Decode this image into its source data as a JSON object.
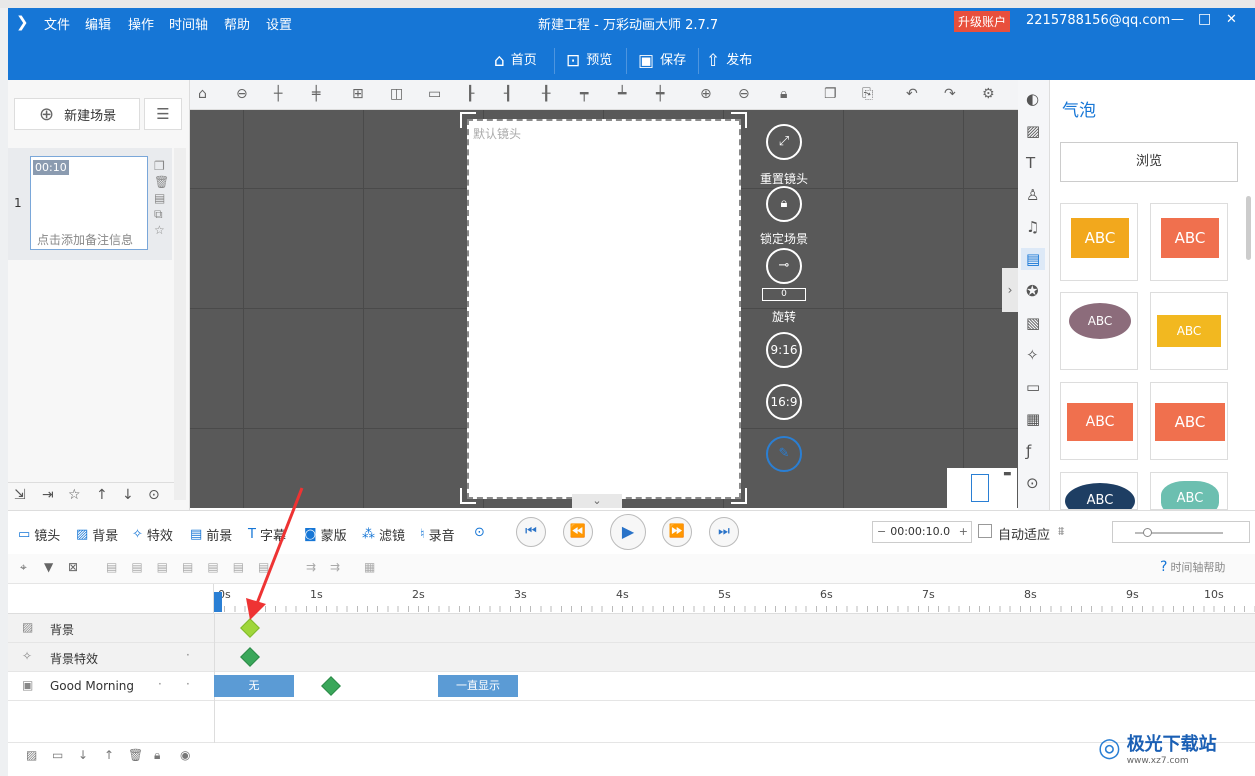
{
  "window": {
    "title": "新建工程 - 万彩动画大师 2.7.7",
    "upgrade": "升级账户",
    "account": "2215788156@qq.com",
    "controls": [
      "—",
      "□",
      "✕"
    ]
  },
  "menu": [
    "文件",
    "编辑",
    "操作",
    "时间轴",
    "帮助",
    "设置"
  ],
  "main_buttons": [
    "首页",
    "预览",
    "保存",
    "发布"
  ],
  "scene_panel": {
    "new_scene": "新建场景",
    "scene_index": "1",
    "scene_time": "00:10",
    "note_placeholder": "点击添加备注信息"
  },
  "canvas": {
    "camera_label": "默认镜头",
    "reset_camera": "重置镜头",
    "lock_scene": "锁定场景",
    "rotate_value": "0",
    "rotate_label": "旋转",
    "ratio_916": "9:16",
    "ratio_169": "16:9"
  },
  "right_panel": {
    "title": "气泡",
    "browse": "浏览",
    "cards": [
      "ABC",
      "ABC",
      "ABC",
      "ABC",
      "ABC",
      "ABC",
      "ABC",
      "ABC"
    ],
    "colors": [
      "#f2a81d",
      "#f0704e",
      "#8c6c7b",
      "#f2b820",
      "#f0704e",
      "#f0704e",
      "#1e3e63",
      "#6cbfb0"
    ]
  },
  "controls": {
    "tabs": [
      "镜头",
      "背景",
      "特效",
      "前景",
      "字幕",
      "蒙版",
      "滤镜",
      "录音"
    ],
    "time": "00:00:10.0",
    "auto_fit": "自动适应",
    "timeline_help": "时间轴帮助"
  },
  "ruler": [
    "0s",
    "1s",
    "2s",
    "3s",
    "4s",
    "5s",
    "6s",
    "7s",
    "8s",
    "9s",
    "10s"
  ],
  "layers": [
    {
      "name": "背景"
    },
    {
      "name": "背景特效"
    },
    {
      "name": "Good Morning"
    }
  ],
  "clips": {
    "clip1": "无",
    "clip2": "一直显示"
  },
  "watermark": {
    "text": "极光下载站",
    "url": "www.xz7.com"
  },
  "accent": "#1676d6"
}
